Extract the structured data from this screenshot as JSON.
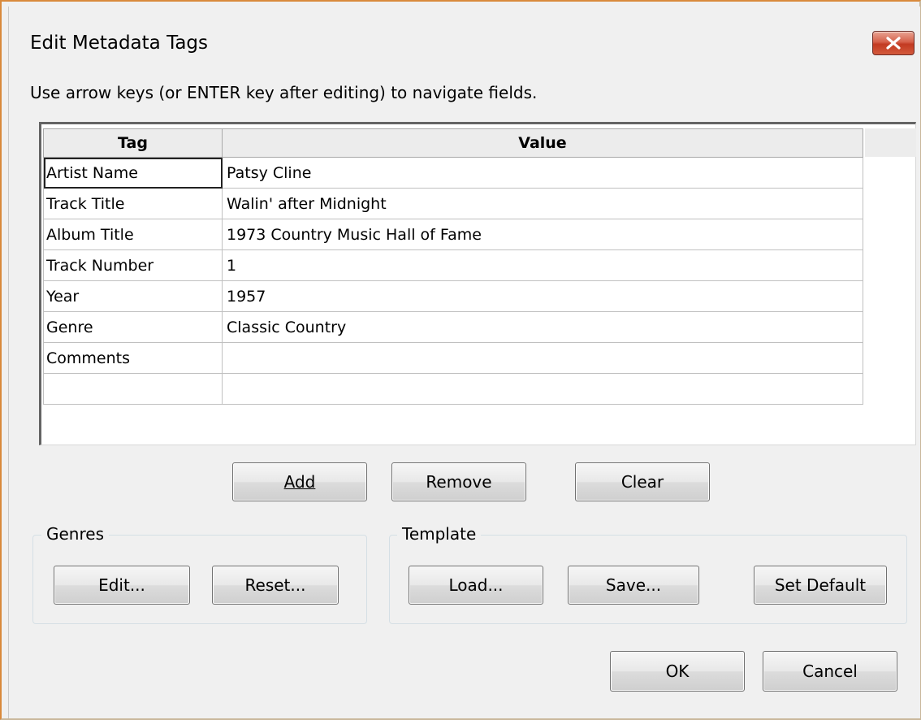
{
  "window": {
    "title": "Edit Metadata Tags",
    "close_label": "✕"
  },
  "instruction": "Use arrow keys (or ENTER key after editing) to navigate fields.",
  "grid": {
    "columns": [
      "Tag",
      "Value"
    ],
    "rows": [
      {
        "tag": "Artist Name",
        "value": "Patsy Cline"
      },
      {
        "tag": "Track Title",
        "value": "Walin' after Midnight"
      },
      {
        "tag": "Album Title",
        "value": "1973 Country Music Hall of Fame"
      },
      {
        "tag": "Track Number",
        "value": "1"
      },
      {
        "tag": "Year",
        "value": "1957"
      },
      {
        "tag": "Genre",
        "value": "Classic Country"
      },
      {
        "tag": "Comments",
        "value": ""
      },
      {
        "tag": "",
        "value": ""
      }
    ]
  },
  "buttons": {
    "add": "Add",
    "remove": "Remove",
    "clear": "Clear",
    "ok": "OK",
    "cancel": "Cancel"
  },
  "genres": {
    "label": "Genres",
    "edit": "Edit...",
    "reset": "Reset..."
  },
  "template": {
    "label": "Template",
    "load": "Load...",
    "save": "Save...",
    "set_default": "Set Default"
  },
  "colors": {
    "window_border": "#d98a3c",
    "close_button": "#c23a22",
    "dialog_bg": "#f0f0f0"
  }
}
